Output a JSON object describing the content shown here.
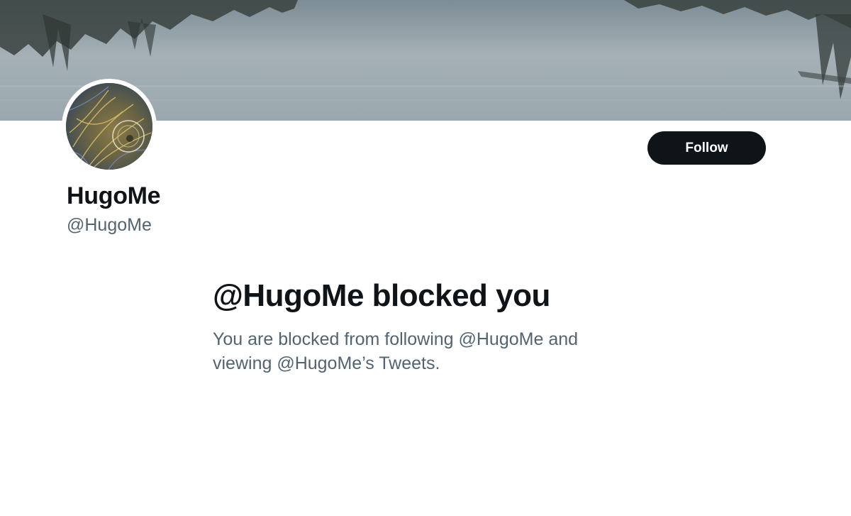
{
  "profile": {
    "display_name": "HugoMe",
    "handle": "@HugoMe"
  },
  "actions": {
    "follow_label": "Follow"
  },
  "blocked": {
    "title": "@HugoMe blocked you",
    "line1": "You are blocked from following @HugoMe and",
    "line2": "viewing @HugoMe’s Tweets."
  },
  "colors": {
    "primary_text": "#0f1419",
    "secondary_text": "#536471",
    "button_bg": "#0f1419",
    "button_text": "#ffffff",
    "background": "#ffffff"
  }
}
